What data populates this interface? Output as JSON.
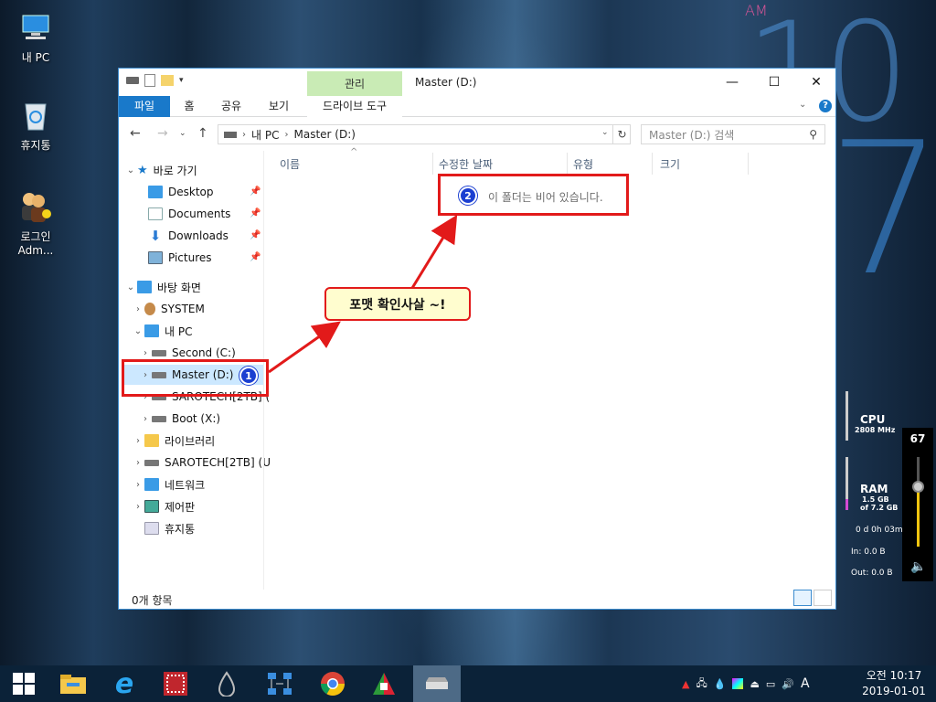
{
  "desktop": {
    "icons": [
      {
        "label": "내 PC"
      },
      {
        "label": "휴지통"
      },
      {
        "label": "로그인Adm..."
      }
    ],
    "clock_am": "AM",
    "clock_digit_1": "1",
    "clock_digit_2": "0",
    "clock_digit_3": "7"
  },
  "window": {
    "title": "Master (D:)",
    "context_tab": "관리",
    "ribbon_tabs": [
      "파일",
      "홈",
      "공유",
      "보기",
      "드라이브 도구"
    ],
    "address": {
      "crumb1": "내 PC",
      "crumb2": "Master (D:)"
    },
    "search_placeholder": "Master (D:) 검색",
    "columns": [
      "이름",
      "수정한 날짜",
      "유형",
      "크기"
    ],
    "empty_message": "이 폴더는 비어 있습니다.",
    "status": "0개 항목"
  },
  "navpane": {
    "quick_access": "바로 가기",
    "pinned": [
      "Desktop",
      "Documents",
      "Downloads",
      "Pictures"
    ],
    "desktop_root": "바탕 화면",
    "system": "SYSTEM",
    "this_pc": "내 PC",
    "drives": [
      "Second (C:)",
      "Master (D:)",
      "SAROTECH[2TB] (",
      "Boot (X:)"
    ],
    "libraries": "라이브러리",
    "sarotech": "SAROTECH[2TB] (U",
    "network": "네트워크",
    "control_panel": "제어판",
    "recycle": "휴지통"
  },
  "annotations": {
    "badge1": "1",
    "badge2": "2",
    "callout": "포맷 확인사살 ~!"
  },
  "gauge": {
    "cpu_label": "CPU",
    "cpu_freq": "2808 MHz",
    "ram_label": "RAM",
    "ram_used": "1.5 GB",
    "ram_total": "of 7.2 GB",
    "uptime": "0 d 0h 03m",
    "net_in": "In: 0.0 B",
    "net_out": "Out: 0.0 B",
    "volume": "67"
  },
  "taskbar": {
    "time": "오전 10:17",
    "date": "2019-01-01",
    "ime": "A"
  },
  "colors": {
    "accent": "#1979ca",
    "annotation_red": "#e21a1a",
    "badge_blue": "#1b3fd1"
  }
}
